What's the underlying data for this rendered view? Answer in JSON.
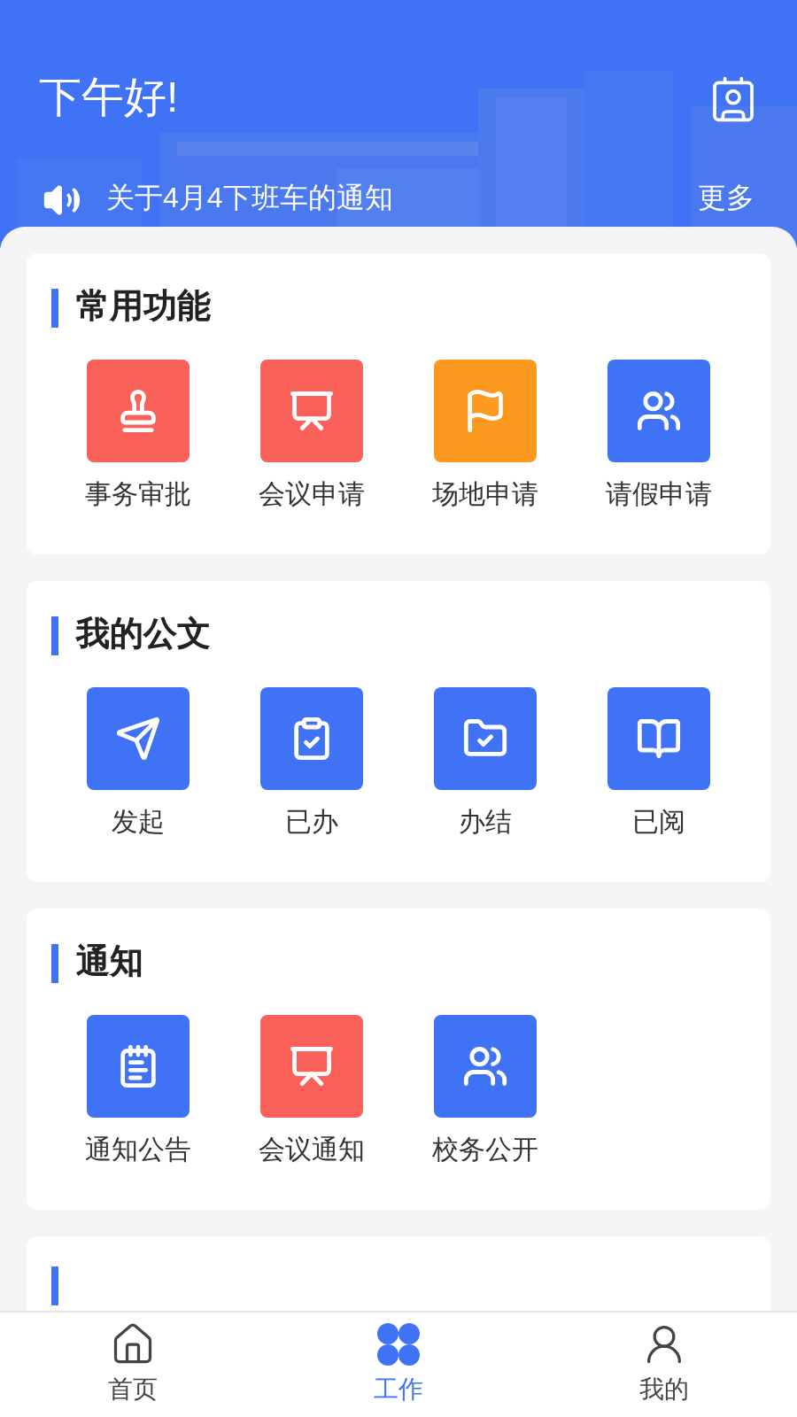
{
  "header": {
    "greeting": "下午好!",
    "notice": "关于4月4下班车的通知",
    "more": "更多"
  },
  "sections": [
    {
      "title": "常用功能",
      "items": [
        {
          "label": "事务审批",
          "color": "#f9615a"
        },
        {
          "label": "会议申请",
          "color": "#f9615a"
        },
        {
          "label": "场地申请",
          "color": "#fb9a1f"
        },
        {
          "label": "请假申请",
          "color": "#3f72f5"
        }
      ]
    },
    {
      "title": "我的公文",
      "items": [
        {
          "label": "发起",
          "color": "#3f72f5"
        },
        {
          "label": "已办",
          "color": "#3f72f5"
        },
        {
          "label": "办结",
          "color": "#3f72f5"
        },
        {
          "label": "已阅",
          "color": "#3f72f5"
        }
      ]
    },
    {
      "title": "通知",
      "items": [
        {
          "label": "通知公告",
          "color": "#3f72f5"
        },
        {
          "label": "会议通知",
          "color": "#f9615a"
        },
        {
          "label": "校务公开",
          "color": "#3f72f5"
        }
      ]
    }
  ],
  "tabs": [
    {
      "label": "首页",
      "selected": false
    },
    {
      "label": "工作",
      "selected": true
    },
    {
      "label": "我的",
      "selected": false
    }
  ]
}
